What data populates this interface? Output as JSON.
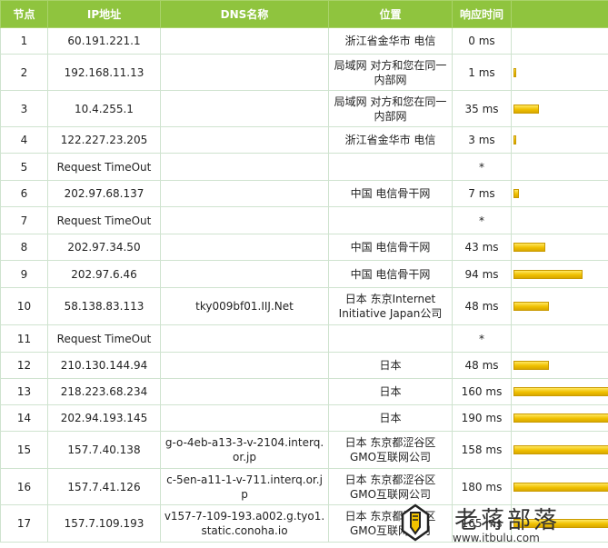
{
  "table": {
    "headers": {
      "node": "节点",
      "ip": "IP地址",
      "dns": "DNS名称",
      "location": "位置",
      "time": "响应时间",
      "bar": ""
    },
    "rows": [
      {
        "node": "1",
        "ip": "60.191.221.1",
        "dns": "",
        "location": "浙江省金华市 电信",
        "time": "0 ms",
        "ms": 0
      },
      {
        "node": "2",
        "ip": "192.168.11.13",
        "dns": "",
        "location": "局域网 对方和您在同一内部网",
        "time": "1 ms",
        "ms": 1
      },
      {
        "node": "3",
        "ip": "10.4.255.1",
        "dns": "",
        "location": "局域网 对方和您在同一内部网",
        "time": "35 ms",
        "ms": 35
      },
      {
        "node": "4",
        "ip": "122.227.23.205",
        "dns": "",
        "location": "浙江省金华市 电信",
        "time": "3 ms",
        "ms": 3
      },
      {
        "node": "5",
        "ip": "Request TimeOut",
        "dns": "",
        "location": "",
        "time": "*",
        "ms": 0
      },
      {
        "node": "6",
        "ip": "202.97.68.137",
        "dns": "",
        "location": "中国 电信骨干网",
        "time": "7 ms",
        "ms": 7
      },
      {
        "node": "7",
        "ip": "Request TimeOut",
        "dns": "",
        "location": "",
        "time": "*",
        "ms": 0
      },
      {
        "node": "8",
        "ip": "202.97.34.50",
        "dns": "",
        "location": "中国 电信骨干网",
        "time": "43 ms",
        "ms": 43
      },
      {
        "node": "9",
        "ip": "202.97.6.46",
        "dns": "",
        "location": "中国 电信骨干网",
        "time": "94 ms",
        "ms": 94
      },
      {
        "node": "10",
        "ip": "58.138.83.113",
        "dns": "tky009bf01.IIJ.Net",
        "location": "日本 东京Internet Initiative Japan公司",
        "time": "48 ms",
        "ms": 48
      },
      {
        "node": "11",
        "ip": "Request TimeOut",
        "dns": "",
        "location": "",
        "time": "*",
        "ms": 0
      },
      {
        "node": "12",
        "ip": "210.130.144.94",
        "dns": "",
        "location": "日本",
        "time": "48 ms",
        "ms": 48
      },
      {
        "node": "13",
        "ip": "218.223.68.234",
        "dns": "",
        "location": "日本",
        "time": "160 ms",
        "ms": 160
      },
      {
        "node": "14",
        "ip": "202.94.193.145",
        "dns": "",
        "location": "日本",
        "time": "190 ms",
        "ms": 190
      },
      {
        "node": "15",
        "ip": "157.7.40.138",
        "dns": "g-o-4eb-a13-3-v-2104.interq.or.jp",
        "location": "日本 东京都涩谷区GMO互联网公司",
        "time": "158 ms",
        "ms": 158
      },
      {
        "node": "16",
        "ip": "157.7.41.126",
        "dns": "c-5en-a11-1-v-711.interq.or.jp",
        "location": "日本 东京都涩谷区GMO互联网公司",
        "time": "180 ms",
        "ms": 180
      },
      {
        "node": "17",
        "ip": "157.7.109.193",
        "dns": "v157-7-109-193.a002.g.tyo1.static.conoha.io",
        "location": "日本 东京都涩谷区GMO互联网公司",
        "time": "165 ms",
        "ms": 165
      }
    ]
  },
  "watermark": {
    "title": "老蒋部落",
    "url": "www.itbulu.com"
  },
  "colors": {
    "header_bg": "#8fc43e",
    "grid": "#cfe3cf",
    "bar": "#f0c000"
  },
  "bar_scale_ms": 130
}
